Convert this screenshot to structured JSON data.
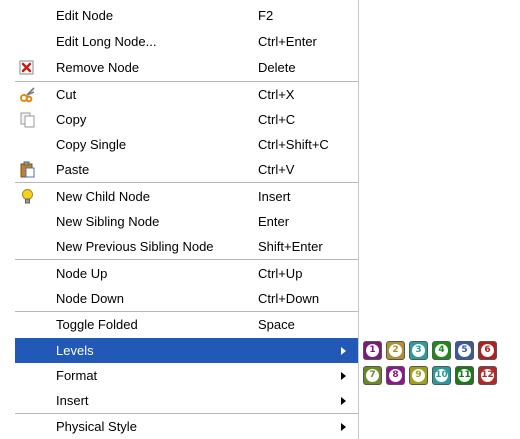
{
  "menu": {
    "items": [
      {
        "label": "Edit Node",
        "shortcut": "F2"
      },
      {
        "label": "Edit Long Node...",
        "shortcut": "Ctrl+Enter"
      },
      {
        "label": "Remove Node",
        "shortcut": "Delete",
        "icon": "remove-icon"
      },
      {
        "label": "Cut",
        "shortcut": "Ctrl+X",
        "icon": "scissors-icon"
      },
      {
        "label": "Copy",
        "shortcut": "Ctrl+C",
        "icon": "copy-icon"
      },
      {
        "label": "Copy Single",
        "shortcut": "Ctrl+Shift+C"
      },
      {
        "label": "Paste",
        "shortcut": "Ctrl+V",
        "icon": "paste-icon"
      },
      {
        "label": "New Child Node",
        "shortcut": "Insert",
        "icon": "lightbulb-icon"
      },
      {
        "label": "New Sibling Node",
        "shortcut": "Enter"
      },
      {
        "label": "New Previous Sibling Node",
        "shortcut": "Shift+Enter"
      },
      {
        "label": "Node Up",
        "shortcut": "Ctrl+Up"
      },
      {
        "label": "Node Down",
        "shortcut": "Ctrl+Down"
      },
      {
        "label": "Toggle Folded",
        "shortcut": "Space"
      },
      {
        "label": "Levels",
        "submenu": true,
        "selected": true
      },
      {
        "label": "Format",
        "submenu": true
      },
      {
        "label": "Insert",
        "submenu": true
      },
      {
        "label": "Physical Style",
        "submenu": true
      }
    ]
  },
  "levels_submenu": {
    "buttons": [
      {
        "number": "1",
        "color": "#7a1a7a"
      },
      {
        "number": "2",
        "color": "#b09030"
      },
      {
        "number": "3",
        "color": "#2c9c9c"
      },
      {
        "number": "4",
        "color": "#1e8a1e"
      },
      {
        "number": "5",
        "color": "#3a5aa0"
      },
      {
        "number": "6",
        "color": "#b02020"
      },
      {
        "number": "7",
        "color": "#6a8a2a"
      },
      {
        "number": "8",
        "color": "#8a1a8a"
      },
      {
        "number": "9",
        "color": "#a0a020"
      },
      {
        "number": "10",
        "color": "#2a9aa0"
      },
      {
        "number": "11",
        "color": "#1a7a1a"
      },
      {
        "number": "12",
        "color": "#b02a2a"
      }
    ]
  },
  "colors": {
    "selection": "#2258b6",
    "separator": "#b8b8b8"
  }
}
